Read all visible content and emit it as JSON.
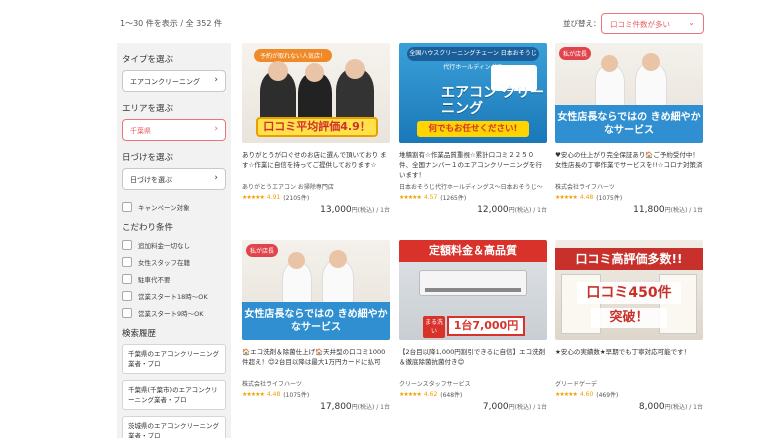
{
  "header": {
    "result_count": "1〜30 件を表示 / 全 352 件",
    "sort_label": "並び替え：",
    "sort_value": "口コミ件数が多い"
  },
  "sidebar": {
    "type_heading": "タイプを選ぶ",
    "type_value": "エアコンクリーニング",
    "area_heading": "エリアを選ぶ",
    "area_value": "千葉県",
    "date_heading": "日づけを選ぶ",
    "date_value": "日づけを選ぶ",
    "campaign_label": "キャンペーン対象",
    "conditions_heading": "こだわり条件",
    "conditions": [
      "追加料金一切なし",
      "女性スタッフ在籍",
      "駐車代不要",
      "営業スタート18時〜OK",
      "営業スタート9時〜OK"
    ],
    "history_heading": "検索履歴",
    "history": [
      "千葉県のエアコンクリーニング業者・プロ",
      "千葉県(千葉市)のエアコンクリーニング業者・プロ",
      "茨城県のエアコンクリーニング業者・プロ"
    ]
  },
  "cards": [
    {
      "thumb_tag": "予約が取れない人気店！",
      "thumb_badge": "口コミ平均評価4.9！",
      "desc": "ありがとうが口ぐせのお店に選んで頂いており ます☆作業に自信を持ってご提供しております☆",
      "shop": "ありがとうエアコン お掃除専門店",
      "stars": "★★★★★",
      "score": "4.91",
      "reviews": "(2105件)",
      "price": "13,000",
      "unit": "円(税込) / 1台"
    },
    {
      "thumb_tag": "全国ハウスクリーニングチェーン 日本おそうじ代行ホールディングス",
      "thumb_title": "エアコン クリーニング",
      "thumb_badge": "何でもお任せください!",
      "desc": "堆積割有☆作業品質重視☆累計口コミ２２５０件、全国ナンバー１のエアコンクリーニングを行います！",
      "shop": "日本おそうじ代行ホールディングス〜日本おそうじ〜",
      "stars": "★★★★★",
      "score": "4.57",
      "reviews": "(1265件)",
      "price": "12,000",
      "unit": "円(税込) / 1台"
    },
    {
      "thumb_tag": "私が店長",
      "thumb_badge": "女性店長ならではの きめ細やかなサービス",
      "desc": "♥安心の仕上がり完全保証あり🏠ご予約受付中！女性店長の丁寧作業でサービスを!!☆コロナ対策済",
      "shop": "株式会社ライフハーツ",
      "stars": "★★★★★",
      "score": "4.48",
      "reviews": "(1075件)",
      "price": "11,800",
      "unit": "円(税込) / 1台"
    },
    {
      "thumb_tag": "私が店長",
      "thumb_badge": "女性店長ならではの きめ細やかなサービス",
      "desc": "🏠エコ洗剤＆除菌仕上げ🏠天井型の口コミ1000件超え！😊2台目以降は最大1万円カードに払可",
      "shop": "株式会社ライフハーツ",
      "stars": "★★★★★",
      "score": "4.48",
      "reviews": "(1075件)",
      "price": "17,800",
      "unit": "円(税込) / 1台"
    },
    {
      "thumb_tag": "定額料金＆高品質",
      "thumb_maru": "まる洗い",
      "thumb_badge": "1台7,000円",
      "desc": "【2台目以降1,000円割引できるに自信】エコ洗剤＆徹底除菌抗菌付き😊",
      "shop": "クリーンスタッフサービス",
      "stars": "★★★★★",
      "score": "4.62",
      "reviews": "(648件)",
      "price": "7,000",
      "unit": "円(税込) / 1台"
    },
    {
      "thumb_tag": "口コミ高評価多数!!",
      "thumb_title": "口コミ450件",
      "thumb_badge": "突破！",
      "desc": "★安心の実績数★早期でも丁寧対応可能です！",
      "shop": "グリードゲーデ",
      "stars": "★★★★★",
      "score": "4.60",
      "reviews": "(469件)",
      "price": "8,000",
      "unit": "円(税込) / 1台"
    }
  ],
  "colors": {
    "accent": "#e85a60",
    "star": "#f0a000",
    "sidebar_bg": "#f2f2f2"
  }
}
